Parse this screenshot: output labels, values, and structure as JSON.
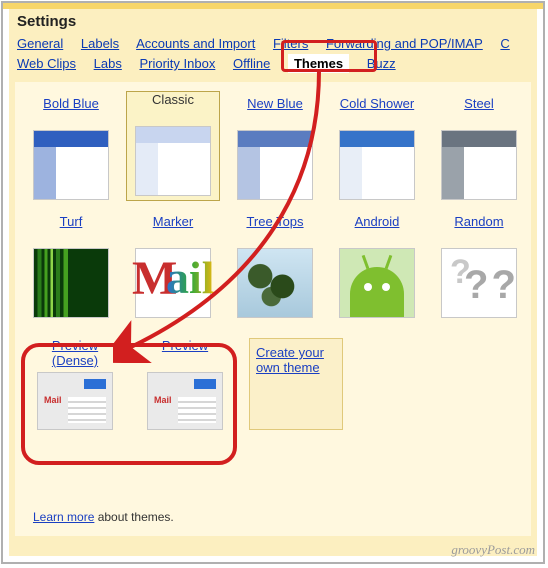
{
  "page_title": "Settings",
  "tabs": {
    "general": "General",
    "labels": "Labels",
    "accounts": "Accounts and Import",
    "filters": "Filters",
    "forwarding": "Forwarding and POP/IMAP",
    "c_trunc": "C",
    "webclips": "Web Clips",
    "labs": "Labs",
    "priority": "Priority Inbox",
    "offline": "Offline",
    "themes": "Themes",
    "buzz": "Buzz"
  },
  "themes": {
    "bold_blue": "Bold Blue",
    "classic": "Classic",
    "new_blue": "New Blue",
    "cold_shower": "Cold Shower",
    "steel": "Steel",
    "turf": "Turf",
    "marker": "Marker",
    "tree_tops": "Tree Tops",
    "android": "Android",
    "random": "Random",
    "preview_dense": "Preview (Dense)",
    "preview": "Preview"
  },
  "create_theme": "Create your own theme",
  "learn_more_link": "Learn more",
  "learn_more_rest": " about themes.",
  "mail_label": "Mail",
  "watermark": "groovyPost.com",
  "colors": {
    "bold_blue_top": "#2f5fbf",
    "bold_blue_side": "#9db3df",
    "classic_top": "#c8d5ef",
    "classic_side": "#e4ebf7",
    "new_blue_top": "#5a7cc0",
    "new_blue_side": "#b4c4e3",
    "cold_top": "#3573c9",
    "cold_side": "#e8eef7",
    "steel_top": "#6a7480",
    "steel_side": "#9aa2aa"
  }
}
